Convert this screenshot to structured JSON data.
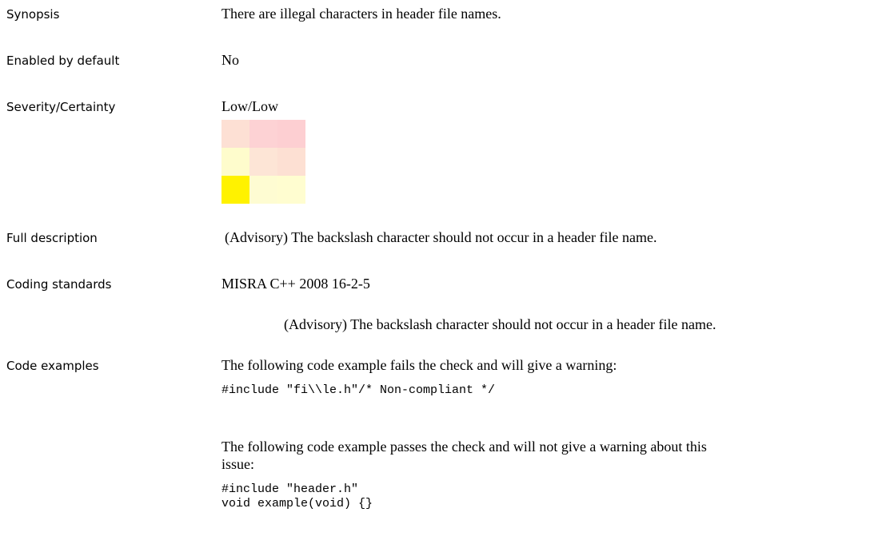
{
  "rows": {
    "synopsis": {
      "label": "Synopsis",
      "value": "There are illegal characters in header file names."
    },
    "enabled": {
      "label": "Enabled by default",
      "value": "No"
    },
    "severity": {
      "label": "Severity/Certainty",
      "value": "Low/Low"
    },
    "full_description": {
      "label": "Full description",
      "value": "(Advisory) The backslash character should not occur in a header file name."
    },
    "coding_standards": {
      "label": "Coding standards",
      "standard": "MISRA C++ 2008 16-2-5",
      "rule_text": "(Advisory) The backslash character should not occur in a header file name."
    },
    "code_examples": {
      "label": "Code examples",
      "fail_intro": "The following code example fails the check and will give a warning:",
      "fail_code": "#include \"fi\\\\le.h\"/* Non-compliant */",
      "pass_intro_line1": "The following code example passes the check and will not give a warning about this",
      "pass_intro_line2": "issue:",
      "pass_code_line1": "#include \"header.h\"",
      "pass_code_line2": "void example(void) {}"
    }
  },
  "severity_matrix": {
    "colors": [
      [
        "#fde0d4",
        "#fdd2d4",
        "#fdcfd2"
      ],
      [
        "#fefccc",
        "#fde5d6",
        "#fde0d3"
      ],
      [
        "#fff200",
        "#fefcd2",
        "#fffdd0"
      ]
    ]
  }
}
